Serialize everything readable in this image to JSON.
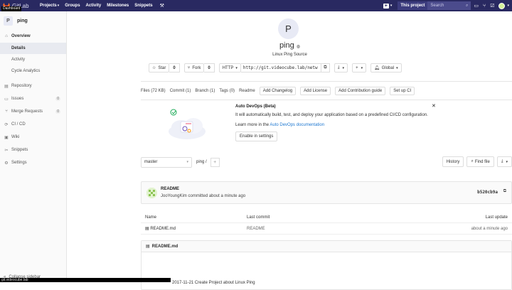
{
  "topnav": {
    "logo_text": "GitLab",
    "tooltip": "Dashboard",
    "links": [
      "Projects",
      "Groups",
      "Activity",
      "Milestones",
      "Snippets"
    ],
    "this_project": "This project",
    "search_placeholder": "Search"
  },
  "sidebar": {
    "project_initial": "P",
    "project_name": "ping",
    "overview": "Overview",
    "sub_items": [
      "Details",
      "Activity",
      "Cycle Analytics"
    ],
    "items": [
      {
        "label": "Repository",
        "count": null
      },
      {
        "label": "Issues",
        "count": "0"
      },
      {
        "label": "Merge Requests",
        "count": "0"
      },
      {
        "label": "CI / CD",
        "count": null
      },
      {
        "label": "Wiki",
        "count": null
      },
      {
        "label": "Snippets",
        "count": null
      },
      {
        "label": "Settings",
        "count": null
      }
    ],
    "collapse": "Collapse sidebar"
  },
  "statusbar": "git.videocube.lab",
  "project": {
    "initial": "P",
    "title": "ping",
    "description": "Linux Ping Source",
    "star_label": "Star",
    "star_count": "0",
    "fork_label": "Fork",
    "fork_count": "0",
    "protocol": "HTTP",
    "clone_url": "http://git.videocube.lab/netw",
    "notification": "Global"
  },
  "files_bar": {
    "links": [
      "Files (72 KB)",
      "Commit (1)",
      "Branch (1)",
      "Tags (0)",
      "Readme"
    ],
    "buttons": [
      "Add Changelog",
      "Add License",
      "Add Contribution guide",
      "Set up CI"
    ]
  },
  "devops": {
    "title": "Auto DevOps (Beta)",
    "text": "It will automatically build, test, and deploy your application based on a predefined CI/CD configuration.",
    "more_prefix": "Learn more in the ",
    "more_link": "Auto DevOps documentation",
    "button": "Enable in settings"
  },
  "branch": {
    "name": "master",
    "crumb": "ping",
    "crumb_sep": "/",
    "history": "History",
    "find_file": "Find file"
  },
  "commit": {
    "title": "README",
    "author": "JooYoungKim",
    "meta": "committed about a minute ago",
    "sha": "b520cb9a"
  },
  "table": {
    "headers": [
      "Name",
      "Last commit",
      "Last update"
    ],
    "rows": [
      {
        "name": "README.md",
        "commit": "README",
        "update": "about a minute ago"
      }
    ]
  },
  "readme": {
    "filename": "README.md",
    "body": "2017-11-21 Create Project about Linux Ping"
  }
}
